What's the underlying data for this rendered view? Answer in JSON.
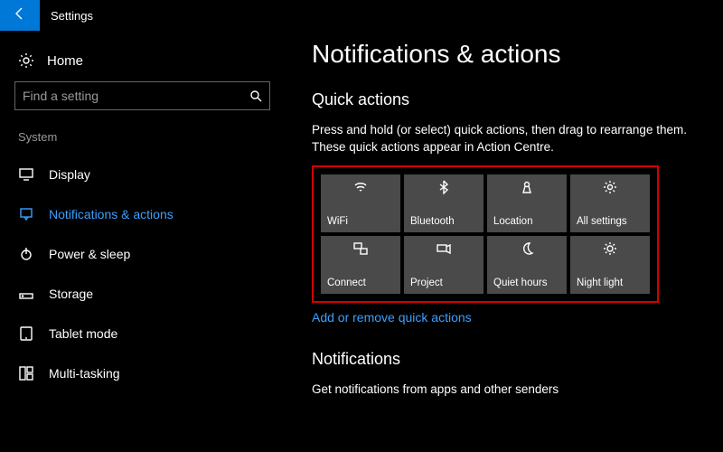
{
  "titlebar": {
    "title": "Settings"
  },
  "sidebar": {
    "home_label": "Home",
    "search_placeholder": "Find a setting",
    "section_label": "System",
    "items": [
      {
        "label": "Display"
      },
      {
        "label": "Notifications & actions"
      },
      {
        "label": "Power & sleep"
      },
      {
        "label": "Storage"
      },
      {
        "label": "Tablet mode"
      },
      {
        "label": "Multi-tasking"
      }
    ]
  },
  "content": {
    "heading": "Notifications & actions",
    "quick_actions_heading": "Quick actions",
    "quick_actions_desc": "Press and hold (or select) quick actions, then drag to rearrange them. These quick actions appear in Action Centre.",
    "tiles": [
      {
        "label": "WiFi"
      },
      {
        "label": "Bluetooth"
      },
      {
        "label": "Location"
      },
      {
        "label": "All settings"
      },
      {
        "label": "Connect"
      },
      {
        "label": "Project"
      },
      {
        "label": "Quiet hours"
      },
      {
        "label": "Night light"
      }
    ],
    "add_remove_link": "Add or remove quick actions",
    "notifications_heading": "Notifications",
    "notifications_desc": "Get notifications from apps and other senders"
  }
}
